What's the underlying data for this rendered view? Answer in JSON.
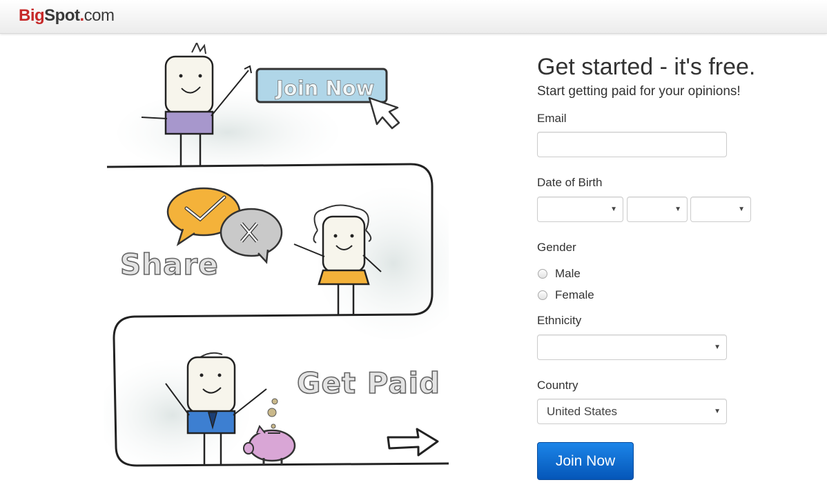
{
  "header": {
    "logo_big": "Big",
    "logo_spot": "Spot",
    "logo_dot": ".",
    "logo_com": "com"
  },
  "illustration": {
    "join_button_text": "Join Now",
    "share_text": "Share",
    "get_paid_text": "Get Paid"
  },
  "form": {
    "title": "Get started - it's free.",
    "subtitle": "Start getting paid for your opinions!",
    "email_label": "Email",
    "email_value": "",
    "dob_label": "Date of Birth",
    "dob_month": "",
    "dob_day": "",
    "dob_year": "",
    "gender_label": "Gender",
    "gender_options": [
      "Male",
      "Female"
    ],
    "ethnicity_label": "Ethnicity",
    "ethnicity_value": "",
    "country_label": "Country",
    "country_value": "United States",
    "submit_label": "Join Now"
  },
  "colors": {
    "logo_red": "#c62828",
    "button_blue": "#0b6fd6",
    "accent_yellow": "#f4b23a",
    "shirt_purple": "#a797cc",
    "shirt_blue": "#3d7fd1",
    "piggy_pink": "#d9a6d6"
  }
}
